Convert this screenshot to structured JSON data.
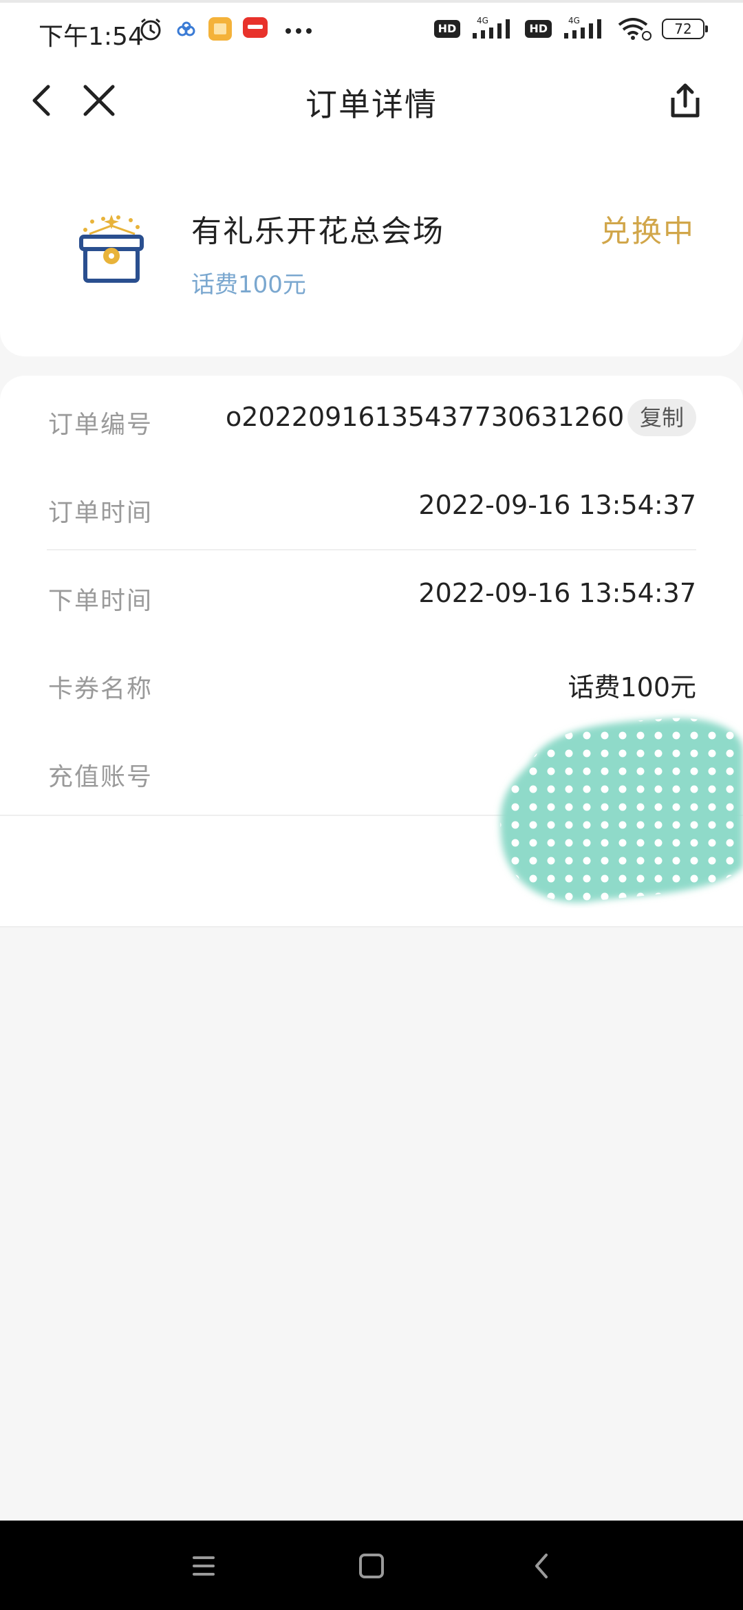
{
  "status_bar": {
    "time": "下午1:54",
    "network_labels": [
      "HD",
      "4G",
      "HD",
      "4G"
    ],
    "battery": "72"
  },
  "nav": {
    "title": "订单详情",
    "icons": [
      "back-icon",
      "close-icon",
      "share-icon"
    ]
  },
  "header": {
    "name": "有礼乐开花总会场",
    "subtitle": "话费100元",
    "status": "兑换中",
    "colors": {
      "status": "#d1a64a",
      "subtitle": "#7aa7cf",
      "icon_blue": "#2a4f8f",
      "icon_gold": "#e8b33a"
    }
  },
  "details": {
    "order_no_label": "订单编号",
    "order_no_value": "o20220916135437730631260",
    "copy_label": "复制",
    "order_time_label": "订单时间",
    "order_time_value": "2022-09-16 13:54:37",
    "place_time_label": "下单时间",
    "place_time_value": "2022-09-16 13:54:37",
    "card_name_label": "卡券名称",
    "card_name_value": "话费100元",
    "account_label": "充值账号"
  },
  "system_nav": {
    "icons": [
      "menu-icon",
      "home-icon",
      "back-nav-icon"
    ]
  }
}
